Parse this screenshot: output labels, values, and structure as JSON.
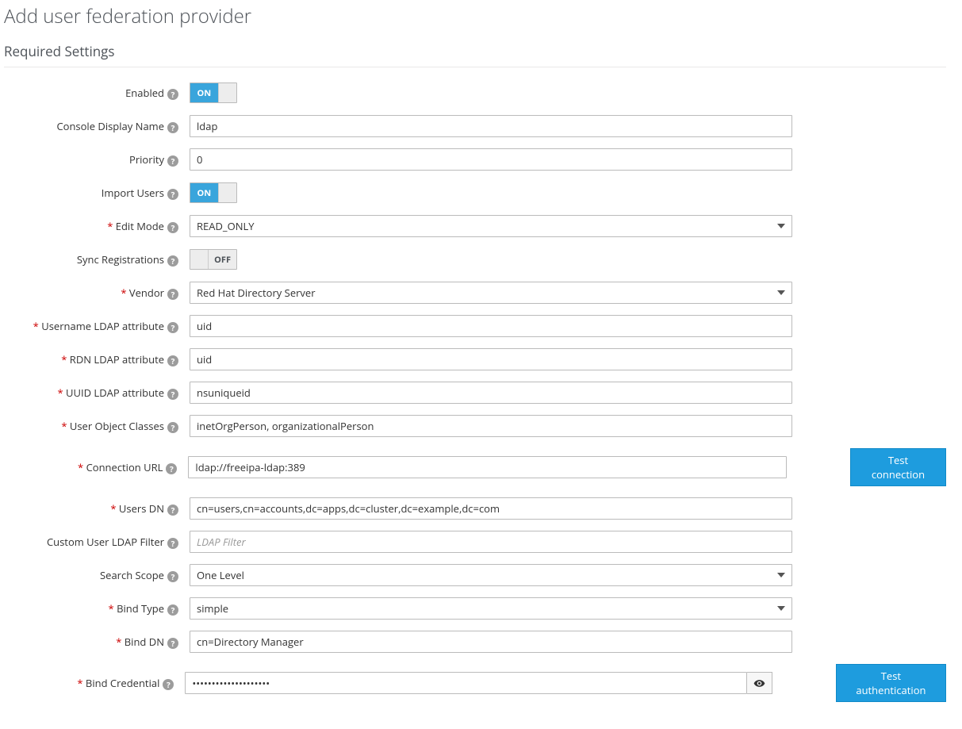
{
  "pageTitle": "Add user federation provider",
  "sectionTitle": "Required Settings",
  "toggleOnLabel": "ON",
  "toggleOffLabel": "OFF",
  "labels": {
    "enabled": "Enabled",
    "consoleDisplayName": "Console Display Name",
    "priority": "Priority",
    "importUsers": "Import Users",
    "editMode": "Edit Mode",
    "syncRegistrations": "Sync Registrations",
    "vendor": "Vendor",
    "usernameLdapAttr": "Username LDAP attribute",
    "rdnLdapAttr": "RDN LDAP attribute",
    "uuidLdapAttr": "UUID LDAP attribute",
    "userObjectClasses": "User Object Classes",
    "connectionUrl": "Connection URL",
    "usersDn": "Users DN",
    "customUserLdapFilter": "Custom User LDAP Filter",
    "searchScope": "Search Scope",
    "bindType": "Bind Type",
    "bindDn": "Bind DN",
    "bindCredential": "Bind Credential"
  },
  "values": {
    "consoleDisplayName": "ldap",
    "priority": "0",
    "editMode": "READ_ONLY",
    "vendor": "Red Hat Directory Server",
    "usernameLdapAttr": "uid",
    "rdnLdapAttr": "uid",
    "uuidLdapAttr": "nsuniqueid",
    "userObjectClasses": "inetOrgPerson, organizationalPerson",
    "connectionUrl": "ldap://freeipa-ldap:389",
    "usersDn": "cn=users,cn=accounts,dc=apps,dc=cluster,dc=example,dc=com",
    "customUserLdapFilter": "",
    "searchScope": "One Level",
    "bindType": "simple",
    "bindDn": "cn=Directory Manager",
    "bindCredential": "••••••••••••••••••••"
  },
  "placeholders": {
    "customUserLdapFilter": "LDAP Filter"
  },
  "buttons": {
    "testConnection": "Test connection",
    "testAuthentication": "Test authentication"
  }
}
